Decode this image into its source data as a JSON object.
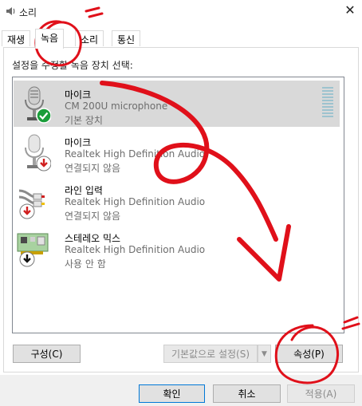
{
  "window": {
    "title": "소리",
    "close_glyph": "✕"
  },
  "tabs": [
    {
      "label": "재생"
    },
    {
      "label": "녹음",
      "active": true
    },
    {
      "label": "소리"
    },
    {
      "label": "통신"
    }
  ],
  "recording": {
    "select_label": "설정을 수정할 녹음 장치 선택:",
    "devices": [
      {
        "name": "마이크",
        "description": "CM 200U microphone",
        "status": "기본 장치",
        "status_icon": "check-icon",
        "selected": true,
        "level": 0
      },
      {
        "name": "마이크",
        "description": "Realtek High Definition Audio",
        "status": "연결되지 않음",
        "status_icon": "unplugged-arrow-icon"
      },
      {
        "name": "라인 입력",
        "description": "Realtek High Definition Audio",
        "status": "연결되지 않음",
        "status_icon": "unplugged-arrow-icon"
      },
      {
        "name": "스테레오 믹스",
        "description": "Realtek High Definition Audio",
        "status": "사용 안 함",
        "status_icon": "disabled-arrow-icon"
      }
    ],
    "buttons": {
      "configure": "구성(C)",
      "set_default": "기본값으로 설정(S)",
      "properties": "속성(P)"
    }
  },
  "footer": {
    "ok": "확인",
    "cancel": "취소",
    "apply": "적용(A)"
  },
  "colors": {
    "accent": "#0078d7",
    "check": "#1a9d3a",
    "unplugged": "#d02020",
    "annotation": "#e0101a"
  }
}
